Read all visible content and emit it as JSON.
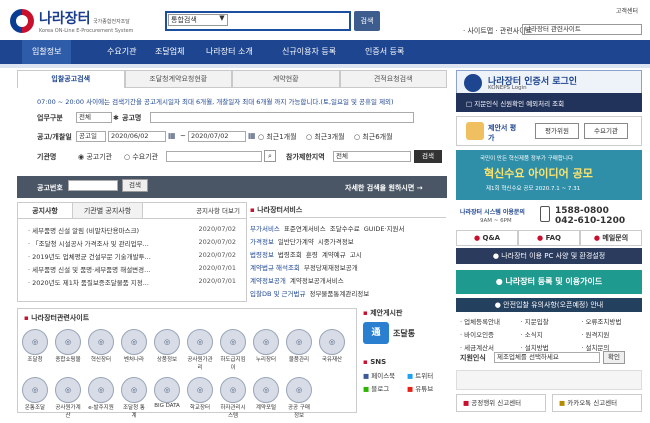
{
  "header": {
    "logo_title": "나라장터",
    "logo_subtitle_kr": "국가종합전자조달",
    "logo_subtitle_en": "Korea ON-Line E-Procurement System",
    "search_select": "통합검색",
    "search_button": "검색",
    "util_link": "고객센터",
    "sitemap_label": "· 사이트맵 · 관련사이트",
    "sitemap_select": "나라장터 관련사이트"
  },
  "nav": {
    "items": [
      "입찰정보",
      "수요기관",
      "조달업체",
      "나라장터 소개",
      "신규이용자 등록",
      "인증서 등록"
    ]
  },
  "search": {
    "tabs": [
      "입찰공고검색",
      "조달청계약요청현황",
      "계약현황",
      "견적요청검색"
    ],
    "notice": "07:00 ~ 20:00 사이에는 검색기간을 공고게시일자 최대 6개월, 개찰일자 최대 6개월 까지 가능합니다.(토,일요일 및 공휴일 제외)",
    "business_label": "업무구분",
    "business_select": "전체",
    "title_label": "공고명",
    "date_label": "공고/개찰일",
    "date_select": "공고일",
    "date_from": "2020/06/02",
    "date_sep": "~",
    "date_to": "2020/07/02",
    "period_options": [
      "최근1개월",
      "최근3개월",
      "최근6개월"
    ],
    "org_label": "기관명",
    "org_options": [
      "공고기관",
      "수요기관"
    ],
    "participation_label": "참가제한지역",
    "participation_select": "전체",
    "search_button": "검색",
    "bidno_label": "공고번호",
    "bidno_button": "검색",
    "detail_link": "자세한 검색을 원하시면 →"
  },
  "notices": {
    "tabs": [
      "공지사항",
      "기관별 공지사항"
    ],
    "more": "공지사항 더보기",
    "items": [
      {
        "title": "세부품명 신설 알림 (비말차단용마스크)",
        "date": "2020/07/02"
      },
      {
        "title": "「조달청 시설공사 가격조사 및 관리업무...",
        "date": "2020/07/02"
      },
      {
        "title": "2019년도 업체평균 건설부문 기술개발투...",
        "date": "2020/07/02"
      },
      {
        "title": "세부품명 신설 및 품명·세부품명 해설변경...",
        "date": "2020/07/01"
      },
      {
        "title": "2020년도 제1차 품질보증조달물품 지정...",
        "date": "2020/07/01"
      }
    ]
  },
  "services": {
    "title": "나라장터서비스",
    "rows": [
      {
        "label": "부가서비스",
        "items": [
          "표준연계서비스",
          "조달수수료",
          "GUIDE·지원서"
        ]
      },
      {
        "label": "가격정보",
        "items": [
          "일반단가계약",
          "시중가격정보"
        ]
      },
      {
        "label": "법령정보",
        "items": [
          "법령조회",
          "훈령",
          "계약예규",
          "고시"
        ]
      },
      {
        "label": "계약법규 해석조회",
        "items": [
          "부정당제재정보공개"
        ]
      },
      {
        "label": "계약정보공개",
        "items": [
          "계약정보공개서비스"
        ]
      },
      {
        "label": "입찰DB 및 근거법규",
        "items": [
          "정부물품통계관리정보"
        ]
      }
    ]
  },
  "related": {
    "title": "나라장터관련사이트",
    "row1": [
      "조달청",
      "종합쇼핑몰",
      "혁신장터",
      "벤처나라",
      "상품정보",
      "공사원가관리",
      "하도급지킴이",
      "누리장터",
      "물품관리",
      "국유재산"
    ],
    "row2": [
      "온통조달",
      "공사원가계산",
      "e-발주지원",
      "조달청 통계",
      "BIG DATA",
      "학교장터",
      "하자관리시스템",
      "계약포털",
      "공공 구매정보"
    ]
  },
  "suggest": {
    "title": "제안게시판",
    "label": "조달통"
  },
  "sns": {
    "title": "SNS",
    "items": [
      "페이스북",
      "트위터",
      "블로그",
      "유튜브"
    ]
  },
  "right": {
    "login_title": "나라장터 인증서 로그인",
    "login_sub": "KONEPS Login",
    "login_check": "지문인식 신원확인 예외처리 조회",
    "keyword_label": "제안서 평가",
    "keyword_buttons": [
      "평가위원",
      "수요기관"
    ],
    "banner_top": "국민이 만든 혁신제품 정부가 구매합니다",
    "banner_main": "혁신수요 아이디어 공모",
    "banner_sub": "제1회 혁신수요 공모 2020.7.1 ~ 7.31",
    "contact_hours": "나라장터 시스템 이용문의",
    "contact_time": "9AM ~ 6PM",
    "phone1": "1588-0800",
    "phone2": "042-610-1200",
    "qa_buttons": [
      "Q&A",
      "FAQ",
      "메일문의"
    ],
    "pc_env": "나라장터 이용 PC 사양 및 환경설정",
    "guide_button": "나라장터 등록 및 이용가이드",
    "guide_bar": "안전입찰 유의사항(오픈예정) 안내",
    "links": [
      "업체등록안내",
      "지문입찰",
      "오류조치방법",
      "바이오인증",
      "소식지",
      "원격지원",
      "세금계산서",
      "설치방법",
      "설치문의"
    ],
    "jiwon_label": "지원인식",
    "jiwon_select": "제조업체를 선택하세요",
    "jiwon_button": "확인",
    "report_label": "공정행위 신고센터",
    "report_right": "카카오톡 신고센터"
  },
  "colors": {
    "navy": "#1e4590",
    "dark": "#22335b",
    "teal": "#1f9a8e",
    "red": "#c8102e"
  }
}
